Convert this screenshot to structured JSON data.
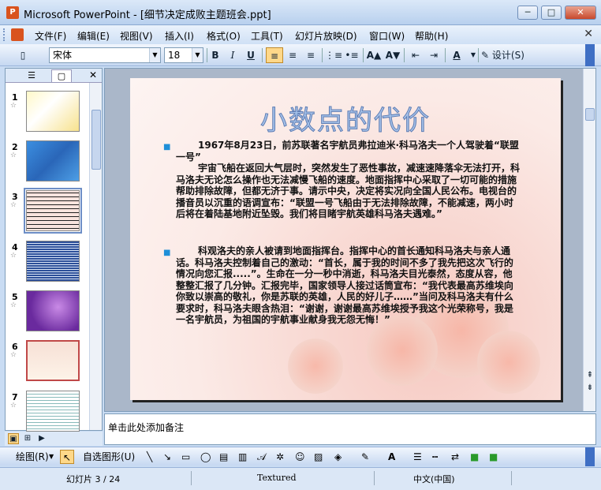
{
  "window": {
    "app_icon": "P",
    "title": "Microsoft PowerPoint - [细节决定成败主题班会.ppt]",
    "minimize": "─",
    "maximize": "□",
    "close": "✕"
  },
  "menu": {
    "items": [
      "文件(F)",
      "编辑(E)",
      "视图(V)",
      "插入(I)",
      "格式(O)",
      "工具(T)",
      "幻灯片放映(D)",
      "窗口(W)",
      "帮助(H)"
    ],
    "close": "✕"
  },
  "toolbar": {
    "font_name": "宋体",
    "font_size": "18",
    "bold": "B",
    "italic": "I",
    "underline": "U",
    "design_label": "设计(S)"
  },
  "left_pane": {
    "tab_outline_icon": "outline-icon",
    "tab_slides_icon": "slides-icon",
    "close": "✕",
    "thumbnails": [
      {
        "num": "1",
        "star": "☆"
      },
      {
        "num": "2",
        "star": "☆"
      },
      {
        "num": "3",
        "star": "☆"
      },
      {
        "num": "4",
        "star": "☆"
      },
      {
        "num": "5",
        "star": "☆"
      },
      {
        "num": "6",
        "star": "☆"
      },
      {
        "num": "7",
        "star": "☆"
      }
    ]
  },
  "slide": {
    "title": "小数点的代价",
    "para1_line1": "1967年8月23日，前苏联著名宇航员弗拉迪米·科马洛夫一个人驾驶着“联盟一号”",
    "para1_rest": "宇宙飞船在返回大气层时，突然发生了恶性事故，减速速降落伞无法打开，科马洛夫无论怎么操作也无法减慢飞船的速度。地面指挥中心采取了一切可能的措施帮助排除故障，但都无济于事。请示中央，决定将实况向全国人民公布。电视台的播音员以沉重的语调宣布：“联盟一号飞船由于无法排除故障，不能减速，两小时后将在着陆基地附近坠毁。我们将目睹宇航英雄科马洛夫遇难。”",
    "para2": "科观洛夫的亲人被请到地面指挥台。指挥中心的首长通知科马洛夫与亲人通话。科马洛夫控制着自己的激动：“首长，属于我的时间不多了我先把这次飞行的情况向您汇报.....”。生命在一分一秒中消逝，科马洛夫目光泰然，态度从容，他整整汇报了几分钟。汇报完毕，国家领导人接过话筒宣布：“我代表最高苏维埃向你致以崇高的敬礼，你是苏联的英雄，人民的好儿子……”当问及科马洛夫有什么要求时，科马洛夫眼含热泪：“谢谢，谢谢最高苏维埃授予我这个光荣称号，我是一名宇航员，为祖国的宇航事业献身我无怨无悔！”"
  },
  "notes": {
    "placeholder": "单击此处添加备注"
  },
  "draw_toolbar": {
    "draw_label": "绘图(R)",
    "autoshapes_label": "自选图形(U)"
  },
  "status": {
    "slide_info": "幻灯片 3 / 24",
    "design": "Textured",
    "language": "中文(中国)"
  }
}
